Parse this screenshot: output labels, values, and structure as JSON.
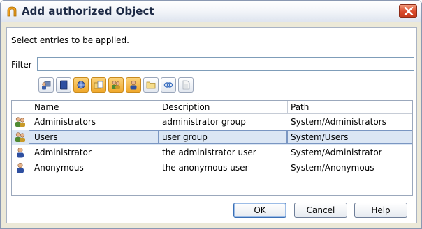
{
  "window": {
    "title": "Add authorized Object"
  },
  "instruction": "Select entries to be applied.",
  "filter": {
    "label": "Filter",
    "value": "",
    "placeholder": ""
  },
  "toolbar": {
    "buttons": [
      {
        "icon": "computer-user-icon",
        "active": false
      },
      {
        "icon": "book-icon",
        "active": false
      },
      {
        "icon": "network-icon",
        "active": true
      },
      {
        "icon": "folder-files-icon",
        "active": true
      },
      {
        "icon": "group-icon",
        "active": true
      },
      {
        "icon": "user-icon",
        "active": true
      },
      {
        "icon": "folder-icon",
        "active": false
      },
      {
        "icon": "link-icon",
        "active": false
      },
      {
        "icon": "document-icon",
        "active": false
      }
    ]
  },
  "table": {
    "headers": {
      "name": "Name",
      "description": "Description",
      "path": "Path"
    },
    "rows": [
      {
        "icon": "group-icon",
        "name": "Administrators",
        "description": "administrator group",
        "path": "System/Administrators",
        "selected": false
      },
      {
        "icon": "group-icon",
        "name": "Users",
        "description": "user group",
        "path": "System/Users",
        "selected": true
      },
      {
        "icon": "user-icon",
        "name": "Administrator",
        "description": "the administrator user",
        "path": "System/Administrator",
        "selected": false
      },
      {
        "icon": "user-icon",
        "name": "Anonymous",
        "description": "the anonymous user",
        "path": "System/Anonymous",
        "selected": false
      }
    ]
  },
  "buttons": {
    "ok": "OK",
    "cancel": "Cancel",
    "help": "Help"
  },
  "colors": {
    "accent": "#f0a92c",
    "selection": "#dbe6f4",
    "close": "#d9492a"
  }
}
